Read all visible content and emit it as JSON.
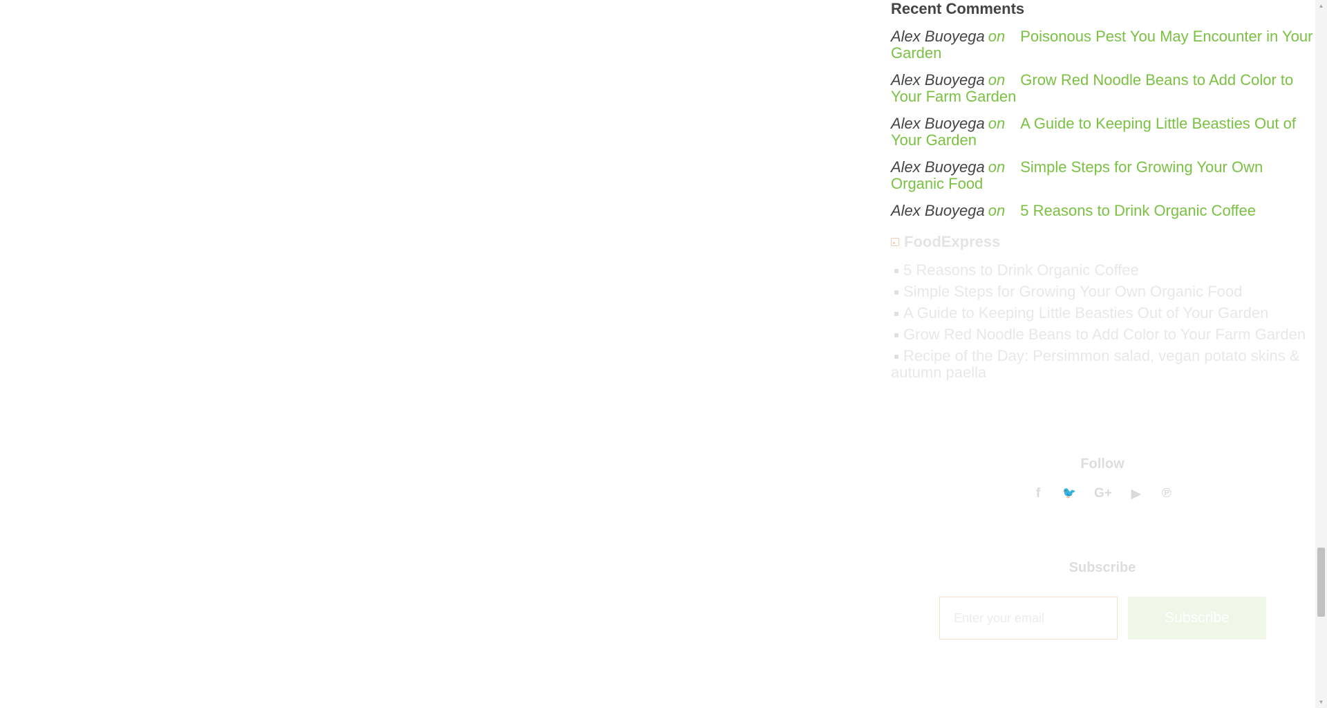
{
  "recent_comments": {
    "title": "Recent Comments",
    "items": [
      {
        "author": "Alex Buoyega",
        "on": "on",
        "post": "Poisonous Pest You May Encounter in Your Garden"
      },
      {
        "author": "Alex Buoyega",
        "on": "on",
        "post": "Grow Red Noodle Beans to Add Color to Your Farm Garden"
      },
      {
        "author": "Alex Buoyega",
        "on": "on",
        "post": "A Guide to Keeping Little Beasties Out of Your Garden"
      },
      {
        "author": "Alex Buoyega",
        "on": "on",
        "post": "Simple Steps for Growing Your Own Organic Food"
      },
      {
        "author": "Alex Buoyega",
        "on": "on",
        "post": "5 Reasons to Drink Organic Coffee"
      }
    ]
  },
  "rss": {
    "title": "FoodExpress",
    "icon": "rss-icon",
    "items": [
      "5 Reasons to Drink Organic Coffee",
      "Simple Steps for Growing Your Own Organic Food",
      "A Guide to Keeping Little Beasties Out of Your Garden",
      "Grow Red Noodle Beans to Add Color to Your Farm Garden",
      "Recipe of the Day: Persimmon salad, vegan potato skins & autumn paella"
    ]
  },
  "follow": {
    "title": "Follow",
    "icons": {
      "facebook": "f",
      "twitter": "🐦",
      "google_plus": "G+",
      "youtube": "▶",
      "pinterest": "℗"
    }
  },
  "subscribe": {
    "title": "Subscribe",
    "email_placeholder": "Enter your email",
    "button_label": "Subscribe"
  },
  "colors": {
    "accent": "#7ac142",
    "text": "#444444",
    "faded": "#e7e7e7"
  }
}
